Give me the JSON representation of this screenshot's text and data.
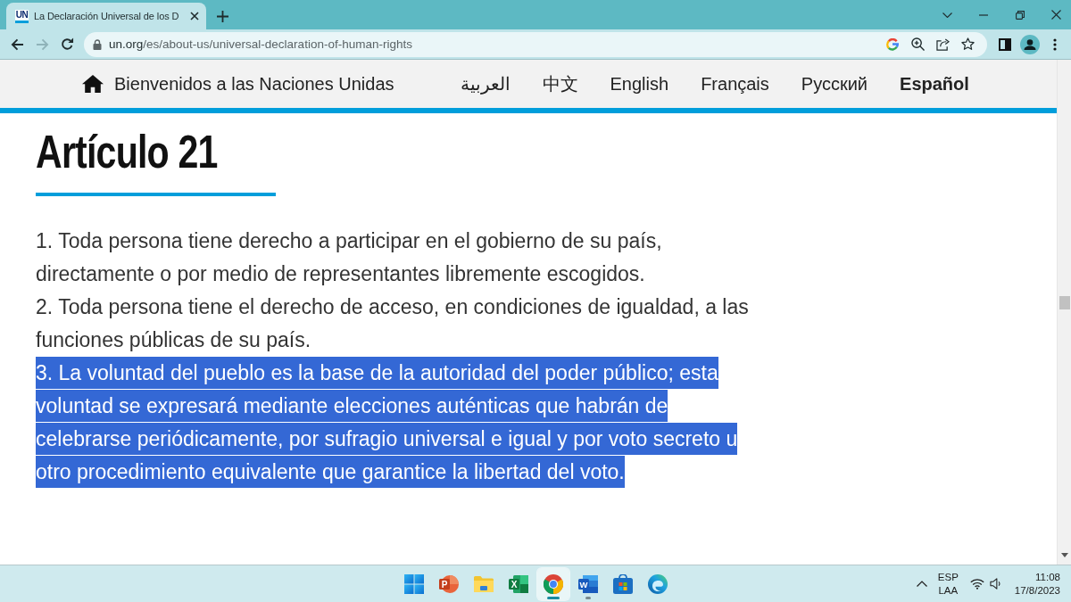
{
  "browser": {
    "tab": {
      "logo_text": "UN",
      "title": "La Declaración Universal de los D",
      "selected": true
    },
    "back": {
      "disabled": false
    },
    "forward": {
      "disabled": true
    },
    "address": {
      "domain": "un.org",
      "path": "/es/about-us/universal-declaration-of-human-rights"
    }
  },
  "nav": {
    "home_label": "Bienvenidos a las Naciones Unidas",
    "languages": [
      {
        "label": "العربية",
        "selected": false
      },
      {
        "label": "中文",
        "selected": false
      },
      {
        "label": "English",
        "selected": false
      },
      {
        "label": "Français",
        "selected": false
      },
      {
        "label": "Русский",
        "selected": false
      },
      {
        "label": "Español",
        "selected": true
      }
    ]
  },
  "article": {
    "title": "Artículo 21",
    "paragraphs": [
      {
        "text": "1. Toda persona tiene derecho a participar en el gobierno de su país, directamente o por medio de representantes libremente escogidos.",
        "highlighted": false
      },
      {
        "text": "2. Toda persona tiene el derecho de acceso, en condiciones de igualdad, a las funciones públicas de su país.",
        "highlighted": false
      },
      {
        "text": "3. La voluntad del pueblo es la base de la autoridad del poder público; esta voluntad se expresará mediante elecciones auténticas que habrán de celebrarse periódicamente, por sufragio universal e igual y por voto secreto u otro procedimiento equivalente que garantice la libertad del voto.",
        "highlighted": true
      }
    ]
  },
  "taskbar": {
    "apps": [
      {
        "kind": "start",
        "running": false,
        "active": false
      },
      {
        "kind": "presentation",
        "letter": "P",
        "running": false,
        "active": false
      },
      {
        "kind": "folder",
        "running": false,
        "active": false
      },
      {
        "kind": "spreadsheet",
        "letter": "X",
        "running": false,
        "active": false
      },
      {
        "kind": "browser",
        "running": true,
        "active": true
      },
      {
        "kind": "document",
        "letter": "W",
        "running": true,
        "active": false
      },
      {
        "kind": "store",
        "running": false,
        "active": false
      },
      {
        "kind": "wave_browser",
        "running": false,
        "active": false
      }
    ],
    "language": "ESP",
    "layout": "LAA",
    "time": "11:08",
    "date": "17/8/2023"
  }
}
